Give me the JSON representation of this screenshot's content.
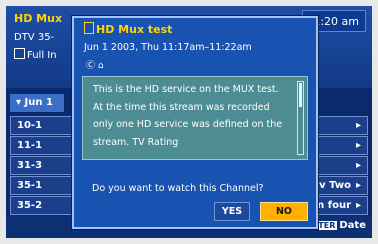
{
  "epg": {
    "title": "HD Mux",
    "line1": "DTV 35-",
    "line2": "Full In",
    "clock": "1:20 am",
    "tab": "Jun 1",
    "rows": [
      {
        "channel": "10-1",
        "right": ""
      },
      {
        "channel": "11-1",
        "right": ""
      },
      {
        "channel": "31-3",
        "right": ""
      },
      {
        "channel": "35-1",
        "right": "v Two"
      },
      {
        "channel": "35-2",
        "right": "n four"
      }
    ],
    "footer_badge": "ENTER",
    "footer_label": "Date"
  },
  "dialog": {
    "title": "HD Mux test",
    "date_time": "Jun 1 2003, Thu 11:17am–11:22am",
    "icons": "Ⓒ ⌂",
    "description": "This is the HD service on the MUX test. At the time this stream was recorded only one HD service was defined on the stream. TV Rating",
    "scroll_position": 0.0,
    "question": "Do you want to watch this Channel?",
    "yes_label": "YES",
    "no_label": "NO"
  }
}
